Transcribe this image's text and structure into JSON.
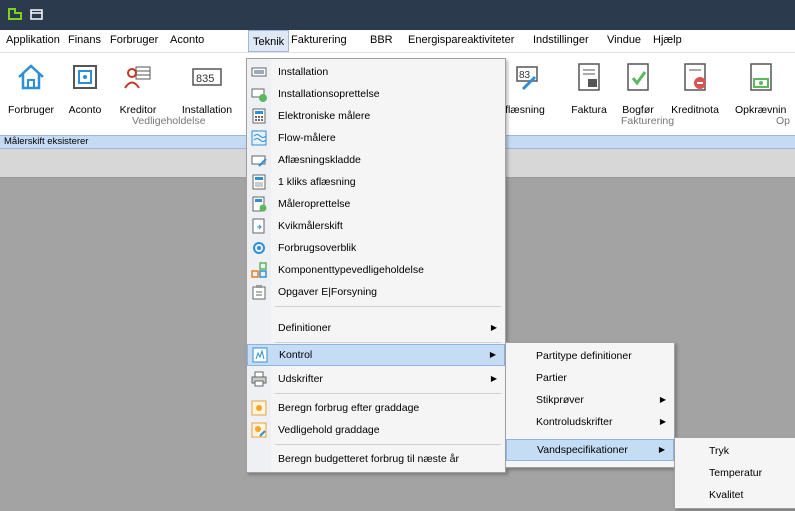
{
  "menubar": {
    "items": [
      "Applikation",
      "Finans",
      "Forbruger",
      "Aconto",
      "Teknik",
      "Fakturering",
      "BBR",
      "Energispareaktiviteter",
      "Indstillinger",
      "Vindue",
      "Hjælp"
    ]
  },
  "ribbon": {
    "buttons": [
      "Forbruger",
      "Aconto",
      "Kreditor",
      "Installation",
      "flæsning",
      "Faktura",
      "Bogfør",
      "Kreditnota",
      "Opkrævnin"
    ],
    "groups": [
      "Vedligeholdelse",
      "Fakturering",
      "Op"
    ]
  },
  "status": {
    "text": "Målerskift eksisterer"
  },
  "teknik_menu": {
    "items": [
      {
        "label": "Installation",
        "icon": "meter-icon"
      },
      {
        "label": "Installationsoprettelse",
        "icon": "meter-add-icon"
      },
      {
        "label": "Elektroniske målere",
        "icon": "calculator-icon"
      },
      {
        "label": "Flow-målere",
        "icon": "flow-icon"
      },
      {
        "label": "Aflæsningskladde",
        "icon": "reading-icon"
      },
      {
        "label": "1 kliks aflæsning",
        "icon": "one-click-icon"
      },
      {
        "label": "Måleroprettelse",
        "icon": "meter-create-icon"
      },
      {
        "label": "Kvikmålerskift",
        "icon": "quick-swap-icon"
      },
      {
        "label": "Forbrugsoverblik",
        "icon": "overview-icon"
      },
      {
        "label": "Komponenttypevedligeholdelse",
        "icon": "components-icon"
      },
      {
        "label": "Opgaver E|Forsyning",
        "icon": "tasks-icon"
      },
      {
        "label": "Definitioner",
        "icon": ""
      },
      {
        "label": "Kontrol",
        "icon": "control-icon"
      },
      {
        "label": "Udskrifter",
        "icon": "printer-icon"
      },
      {
        "label": "Beregn forbrug efter graddage",
        "icon": "sun-icon"
      },
      {
        "label": "Vedligehold graddage",
        "icon": "sun-edit-icon"
      },
      {
        "label": "Beregn budgetteret forbrug til næste år",
        "icon": ""
      }
    ]
  },
  "kontrol_menu": {
    "items": [
      "Partitype definitioner",
      "Partier",
      "Stikprøver",
      "Kontroludskrifter",
      "Vandspecifikationer"
    ]
  },
  "vand_menu": {
    "items": [
      "Tryk",
      "Temperatur",
      "Kvalitet"
    ]
  }
}
